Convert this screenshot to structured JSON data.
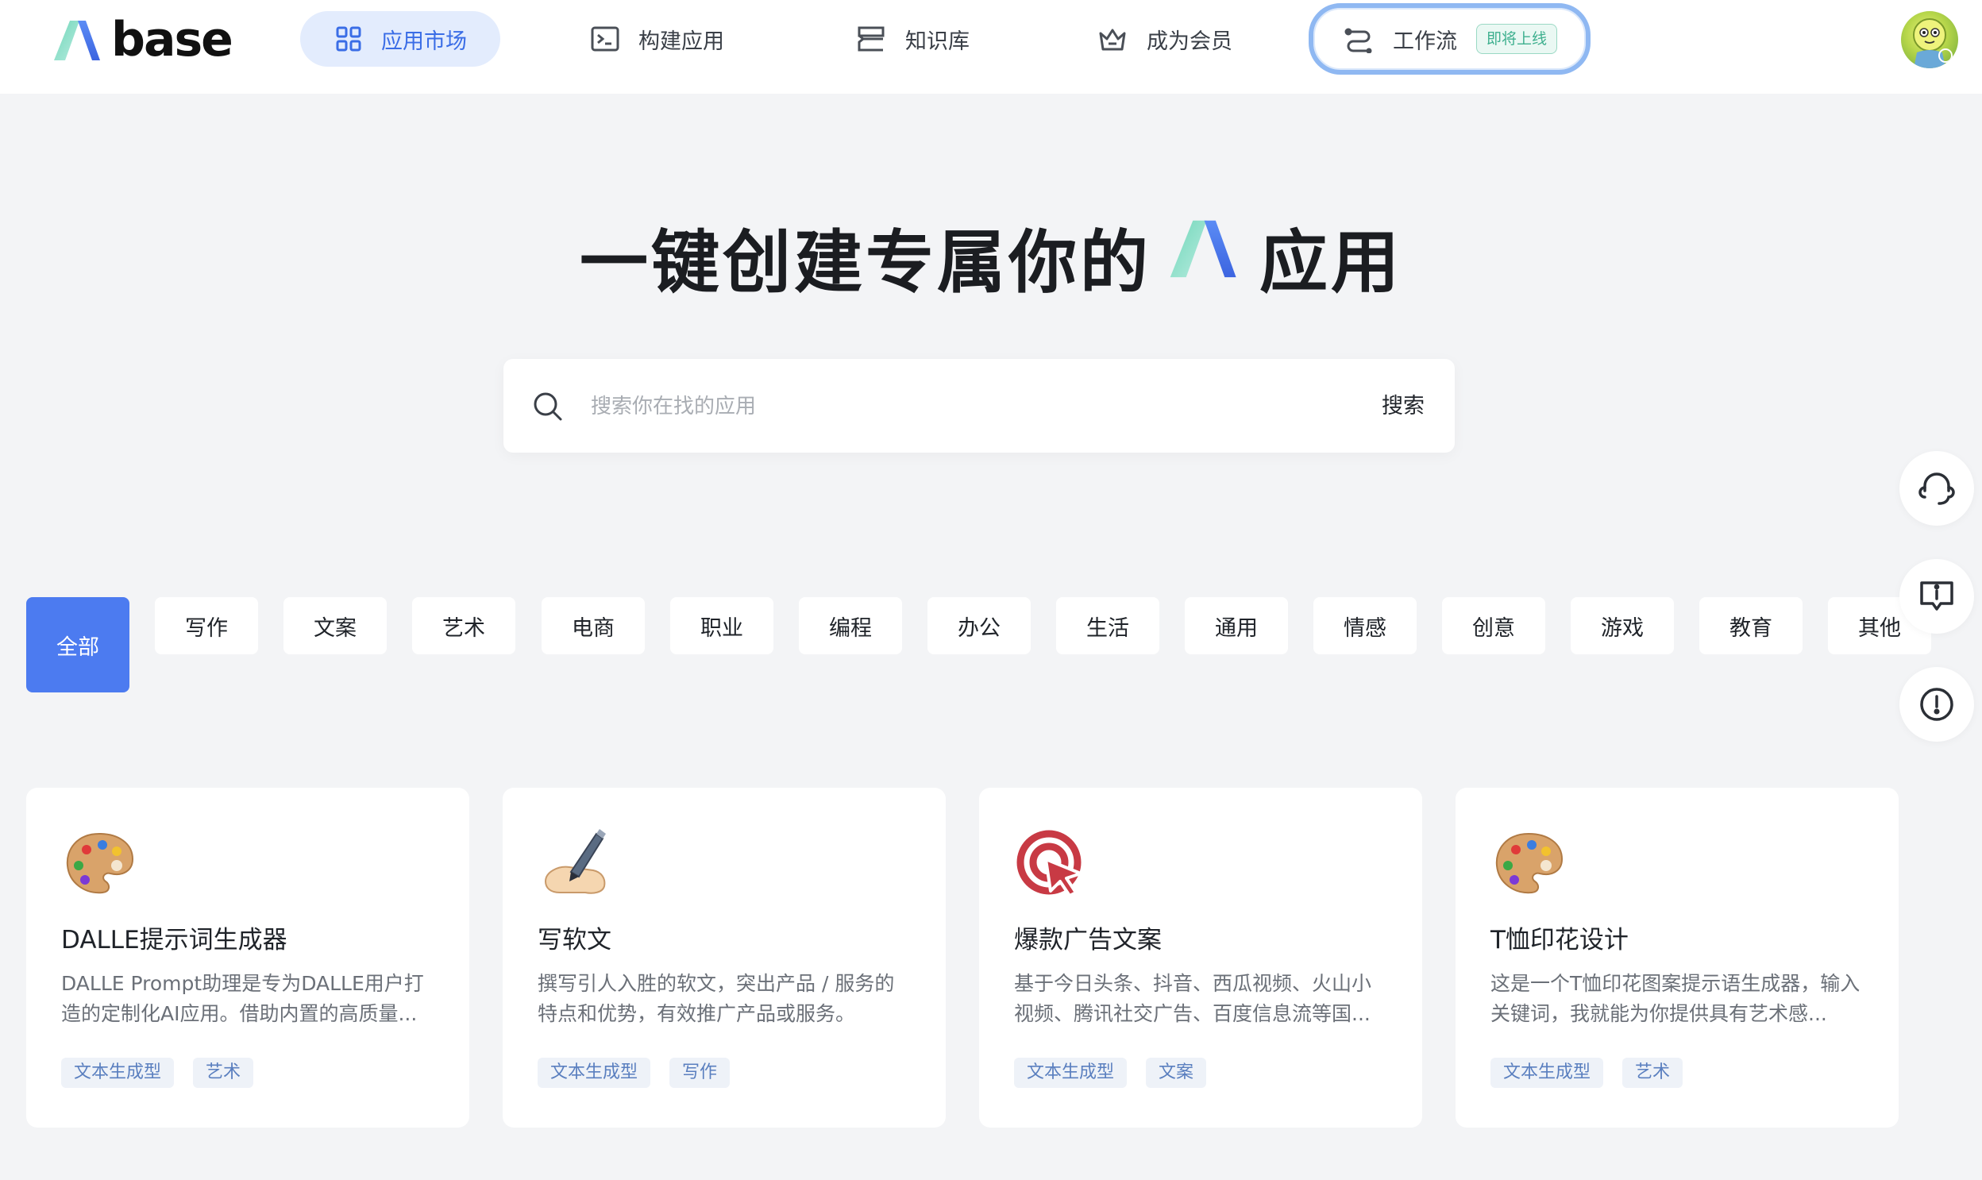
{
  "brand": {
    "name": "base"
  },
  "nav": {
    "items": [
      {
        "label": "应用市场",
        "icon": "grid-icon"
      },
      {
        "label": "构建应用",
        "icon": "terminal-icon"
      },
      {
        "label": "知识库",
        "icon": "database-icon"
      },
      {
        "label": "成为会员",
        "icon": "crown-icon"
      },
      {
        "label": "工作流",
        "icon": "workflow-icon",
        "badge": "即将上线"
      }
    ]
  },
  "hero": {
    "title_before": "一键创建专属你的",
    "title_after": "应用"
  },
  "search": {
    "placeholder": "搜索你在找的应用",
    "button": "搜索"
  },
  "categories": [
    "全部",
    "写作",
    "文案",
    "艺术",
    "电商",
    "职业",
    "编程",
    "办公",
    "生活",
    "通用",
    "情感",
    "创意",
    "游戏",
    "教育",
    "其他"
  ],
  "floating": [
    "headset-icon",
    "feedback-icon",
    "alert-icon"
  ],
  "cards": [
    {
      "icon": "palette-icon",
      "title": "DALLE提示词生成器",
      "desc": "DALLE Prompt助理是专为DALLE用户打造的定制化AI应用。借助内置的高质量...",
      "tags": [
        "文本生成型",
        "艺术"
      ]
    },
    {
      "icon": "writing-hand-icon",
      "title": "写软文",
      "desc": "撰写引人入胜的软文，突出产品 / 服务的特点和优势，有效推广产品或服务。",
      "tags": [
        "文本生成型",
        "写作"
      ]
    },
    {
      "icon": "target-cursor-icon",
      "title": "爆款广告文案",
      "desc": "基于今日头条、抖音、西瓜视频、火山小视频、腾讯社交广告、百度信息流等国...",
      "tags": [
        "文本生成型",
        "文案"
      ]
    },
    {
      "icon": "palette-icon",
      "title": "T恤印花设计",
      "desc": "这是一个T恤印花图案提示语生成器，输入关键词，我就能为你提供具有艺术感...",
      "tags": [
        "文本生成型",
        "艺术"
      ]
    }
  ],
  "colors": {
    "accent": "#4c7bf0",
    "nav_active_bg": "#e3ecfd",
    "badge_green": "#3fb08f",
    "page_bg": "#f3f4f6"
  }
}
